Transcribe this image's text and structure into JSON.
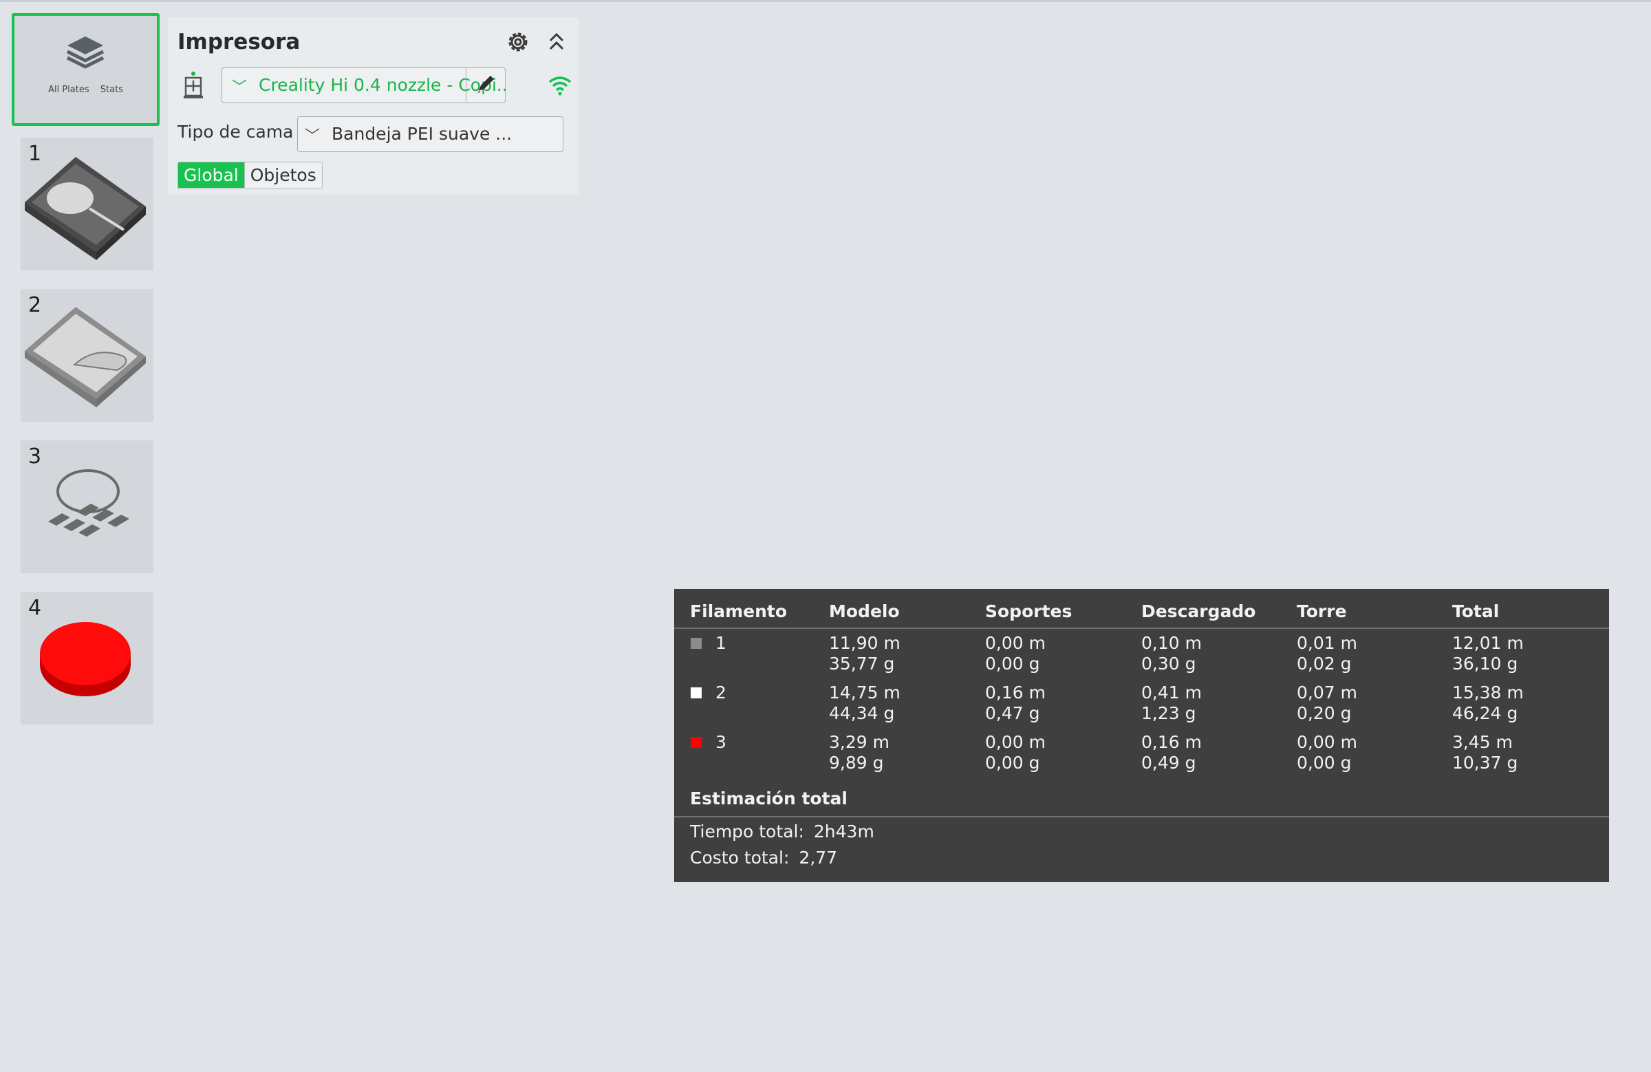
{
  "plates": {
    "all": {
      "labels": [
        "All Plates",
        "Stats"
      ]
    },
    "items": [
      {
        "number": "1"
      },
      {
        "number": "2"
      },
      {
        "number": "3"
      },
      {
        "number": "4"
      }
    ]
  },
  "printer_panel": {
    "title": "Impresora",
    "printer_name": "Creality Hi 0.4 nozzle - Copi..",
    "bed_label": "Tipo de cama",
    "bed_value": "Bandeja PEI suave ...",
    "tabs": [
      "Global",
      "Objetos"
    ],
    "accent_color": "#19c24e"
  },
  "stats": {
    "headers": [
      "Filamento",
      "Modelo",
      "Soportes",
      "Descargado",
      "Torre",
      "Total"
    ],
    "rows": [
      {
        "id": "1",
        "color": "#8c8c8c",
        "modelo": [
          "11,90 m",
          "35,77 g"
        ],
        "soportes": [
          "0,00 m",
          "0,00 g"
        ],
        "descargado": [
          "0,10 m",
          "0,30 g"
        ],
        "torre": [
          "0,01 m",
          "0,02 g"
        ],
        "total": [
          "12,01 m",
          "36,10 g"
        ]
      },
      {
        "id": "2",
        "color": "#ffffff",
        "modelo": [
          "14,75 m",
          "44,34 g"
        ],
        "soportes": [
          "0,16 m",
          "0,47 g"
        ],
        "descargado": [
          "0,41 m",
          "1,23 g"
        ],
        "torre": [
          "0,07 m",
          "0,20 g"
        ],
        "total": [
          "15,38 m",
          "46,24 g"
        ]
      },
      {
        "id": "3",
        "color": "#ff0000",
        "modelo": [
          "3,29 m",
          "9,89 g"
        ],
        "soportes": [
          "0,00 m",
          "0,00 g"
        ],
        "descargado": [
          "0,16 m",
          "0,49 g"
        ],
        "torre": [
          "0,00 m",
          "0,00 g"
        ],
        "total": [
          "3,45 m",
          "10,37 g"
        ]
      }
    ],
    "summary_title": "Estimación total",
    "time_label": "Tiempo total:",
    "time_value": "2h43m",
    "cost_label": "Costo total:",
    "cost_value": "2,77"
  }
}
